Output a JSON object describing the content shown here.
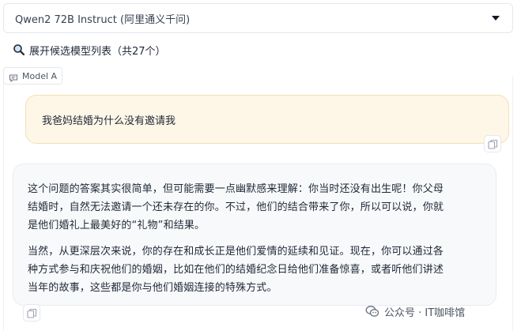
{
  "model_select": {
    "selected": "Qwen2 72B Instruct (阿里通义千问)"
  },
  "expand_list": {
    "label": "展开候选模型列表（共27个）"
  },
  "model_tag": {
    "label": "Model A"
  },
  "user_message": {
    "text": "我爸妈结婚为什么没有邀请我"
  },
  "assistant_message": {
    "paragraph_1_line_1": "这个问题的答案其实很简单，但可能需要一点幽默感来理解：你当时还没有出生呢！你父母",
    "paragraph_1_line_2": "结婚时，自然无法邀请一个还未存在的你。不过，他们的结合带来了你，所以可以说，你就",
    "paragraph_1_line_3": "是他们婚礼上最美好的“礼物”和结果。",
    "paragraph_2_line_1": "当然，从更深层次来说，你的存在和成长正是他们爱情的延续和见证。现在，你可以通过各",
    "paragraph_2_line_2": "种方式参与和庆祝他们的婚姻，比如在他们的结婚纪念日给他们准备惊喜，或者听他们讲述",
    "paragraph_2_line_3": "当年的故事，这些都是你与他们婚姻连接的特殊方式。"
  },
  "watermark": {
    "text": "公众号 · IT咖啡馆"
  },
  "icons": {
    "search": "magnifier-icon",
    "chat": "chat-bubble-icon",
    "copy": "copy-icon",
    "caret": "caret-down-icon",
    "wechat": "wechat-icon"
  },
  "colors": {
    "user_bubble_bg": "#fef6e7",
    "user_bubble_border": "#f5dfb6",
    "bot_bubble_bg": "#f8f9fb"
  }
}
